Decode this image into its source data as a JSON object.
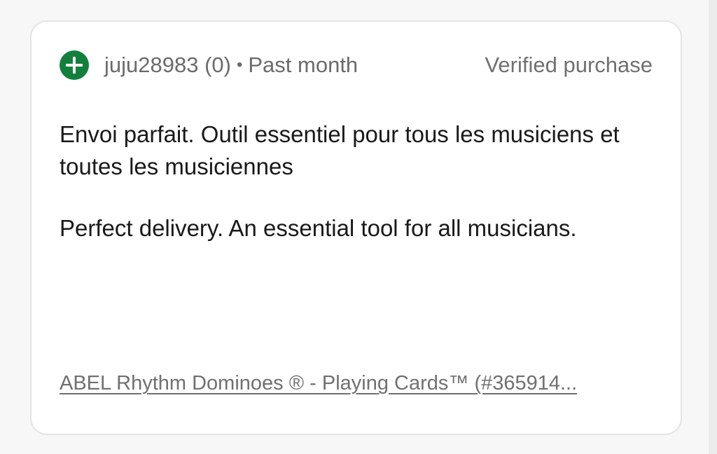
{
  "review": {
    "reviewer_name": "juju28983 (0)",
    "separator": "•",
    "date": "Past month",
    "verified_label": "Verified purchase",
    "rating_icon": "plus-circle-icon",
    "rating_color": "#12803c",
    "text_original": "Envoi parfait. Outil essentiel pour tous les musiciens et toutes les musiciennes",
    "text_translated": "Perfect delivery. An essential tool for all musicians.",
    "product_link": "ABEL Rhythm Dominoes ® - Playing Cards™ (#365914..."
  }
}
